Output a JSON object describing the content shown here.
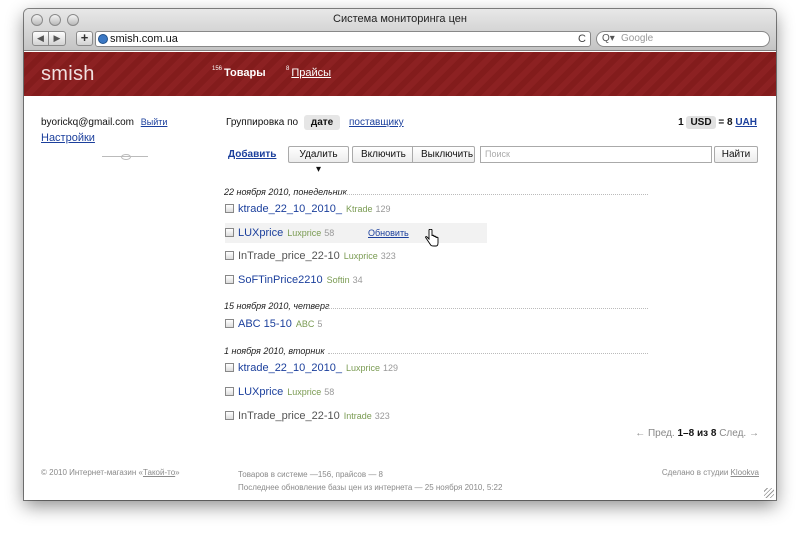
{
  "browser": {
    "window_title": "Система мониторинга цен",
    "url": "smish.com.ua",
    "search_placeholder": "Google",
    "back_icon": "◀",
    "forward_icon": "▶",
    "plus_icon": "+",
    "reload_icon": "C"
  },
  "header": {
    "logo": "smish",
    "nav": [
      {
        "count": "156",
        "label": "Товары"
      },
      {
        "count": "8",
        "label": "Прайсы"
      }
    ]
  },
  "user": {
    "email": "byorickq@gmail.com",
    "logout": "Выйти",
    "settings": "Настройки"
  },
  "grouping": {
    "label": "Группировка по",
    "by_date": "дате",
    "by_supplier": "поставщику"
  },
  "currency": {
    "left_amount": "1",
    "left_code": "USD",
    "eq": "=",
    "right_amount": "8",
    "right_code": "UAH"
  },
  "toolbar": {
    "add": "Добавить",
    "delete": "Удалить ▾",
    "enable": "Включить",
    "disable": "Выключить",
    "search_placeholder": "Поиск",
    "find": "Найти"
  },
  "groups": [
    {
      "date": "22 ноября 2010, понедельник",
      "items": [
        {
          "name": "ktrade_22_10_2010_",
          "supplier": "Ktrade",
          "count": "129"
        },
        {
          "name": "LUXprice",
          "supplier": "Luxprice",
          "count": "58",
          "action": "Обновить"
        },
        {
          "name": "InTrade_price_22-10",
          "supplier": "Luxprice",
          "count": "323"
        },
        {
          "name": "SoFTinPrice2210",
          "supplier": "Softin",
          "count": "34"
        }
      ]
    },
    {
      "date": "15 ноября 2010, четверг",
      "items": [
        {
          "name": "ABC 15-10",
          "supplier": "ABC",
          "count": "5"
        }
      ]
    },
    {
      "date": "1 ноября 2010, вторник",
      "items": [
        {
          "name": "ktrade_22_10_2010_",
          "supplier": "Luxprice",
          "count": "129"
        },
        {
          "name": "LUXprice",
          "supplier": "Luxprice",
          "count": "58"
        },
        {
          "name": "InTrade_price_22-10",
          "supplier": "Intrade",
          "count": "323"
        }
      ]
    }
  ],
  "pager": {
    "prev": "← Пред.",
    "range": "1–8",
    "of": "из",
    "total": "8",
    "next": "След. →"
  },
  "footer": {
    "copyright_prefix": "© 2010 Интернет-магазин «",
    "copyright_link": "Такой-то",
    "copyright_suffix": "»",
    "stats_line1": "Товаров в системе —156, прайсов — 8",
    "stats_line2": "Последнее обновление базы цен из интернета — 25 ноября 2010, 5:22",
    "made_prefix": "Сделано в студии",
    "made_link": "Klookva"
  },
  "colors": {
    "header": "#8a1d1e",
    "link": "#1b3f9c",
    "supplier": "#7a9b52"
  }
}
